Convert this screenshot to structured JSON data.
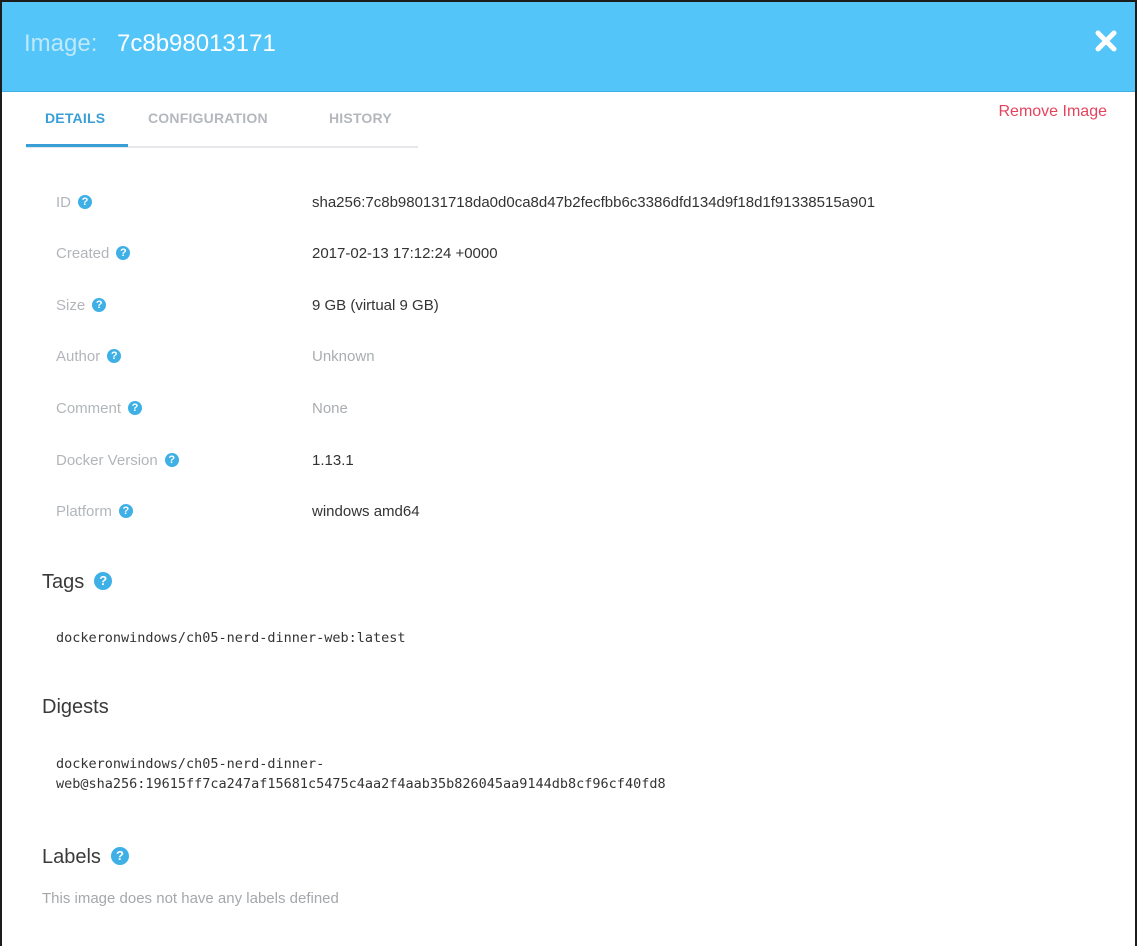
{
  "header": {
    "title_prefix": "Image:",
    "image_id_short": "7c8b98013171"
  },
  "tabs": [
    {
      "label": "DETAILS",
      "active": true
    },
    {
      "label": "CONFIGURATION",
      "active": false
    },
    {
      "label": "HISTORY",
      "active": false
    }
  ],
  "actions": {
    "remove_image": "Remove Image"
  },
  "details": [
    {
      "label": "ID",
      "value": "sha256:7c8b980131718da0d0ca8d47b2fecfbb6c3386dfd134d9f18d1f91338515a901"
    },
    {
      "label": "Created",
      "value": "2017-02-13 17:12:24 +0000"
    },
    {
      "label": "Size",
      "value": "9 GB (virtual 9 GB)"
    },
    {
      "label": "Author",
      "value": "Unknown"
    },
    {
      "label": "Comment",
      "value": "None"
    },
    {
      "label": "Docker Version",
      "value": "1.13.1"
    },
    {
      "label": "Platform",
      "value": "windows amd64"
    }
  ],
  "tags": {
    "title": "Tags",
    "items": [
      "dockeronwindows/ch05-nerd-dinner-web:latest"
    ]
  },
  "digests": {
    "title": "Digests",
    "line1": "dockeronwindows/ch05-nerd-dinner-",
    "line2": "web@sha256:19615ff7ca247af15681c5475c4aa2f4aab35b826045aa9144db8cf96cf40fd8"
  },
  "labels": {
    "title": "Labels",
    "empty_text": "This image does not have any labels defined"
  },
  "icons": {
    "close": "close-icon",
    "help": "question-circle-icon"
  },
  "colors": {
    "header_bg": "#54c5f8",
    "accent": "#3a9fd6",
    "danger": "#e5435d"
  }
}
